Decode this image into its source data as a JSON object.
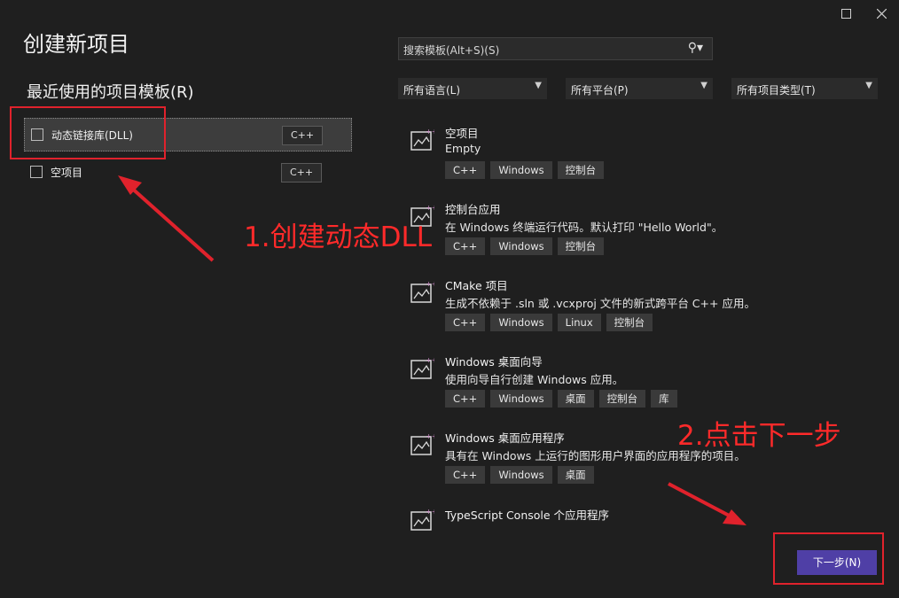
{
  "window": {
    "title": "创建新项目",
    "controls": {
      "maximize_icon": "maximize-icon",
      "close_icon": "close-icon"
    }
  },
  "recent": {
    "heading": "最近使用的项目模板(R)",
    "items": [
      {
        "label": "动态链接库(DLL)",
        "lang": "C++",
        "selected": true
      },
      {
        "label": "空项目",
        "lang": "C++",
        "selected": false
      }
    ]
  },
  "search": {
    "placeholder": "搜索模板(Alt+S)(S)",
    "icon": "search-icon"
  },
  "filters": [
    {
      "label": "所有语言(L)"
    },
    {
      "label": "所有平台(P)"
    },
    {
      "label": "所有项目类型(T)"
    }
  ],
  "templates": [
    {
      "name": "空项目",
      "desc": "Empty",
      "tags": [
        "C++",
        "Windows",
        "控制台"
      ],
      "icon": "empty-project-icon"
    },
    {
      "name": "控制台应用",
      "desc": "在 Windows 终端运行代码。默认打印 \"Hello World\"。",
      "tags": [
        "C++",
        "Windows",
        "控制台"
      ],
      "icon": "console-app-icon"
    },
    {
      "name": "CMake 项目",
      "desc": "生成不依赖于 .sln 或 .vcxproj 文件的新式跨平台 C++ 应用。",
      "tags": [
        "C++",
        "Windows",
        "Linux",
        "控制台"
      ],
      "icon": "cmake-project-icon"
    },
    {
      "name": "Windows 桌面向导",
      "desc": "使用向导自行创建 Windows 应用。",
      "tags": [
        "C++",
        "Windows",
        "桌面",
        "控制台",
        "库"
      ],
      "icon": "desktop-wizard-icon"
    },
    {
      "name": "Windows 桌面应用程序",
      "desc": "具有在 Windows 上运行的图形用户界面的应用程序的项目。",
      "tags": [
        "C++",
        "Windows",
        "桌面"
      ],
      "icon": "desktop-app-icon"
    },
    {
      "name": "TypeScript Console 个应用程序",
      "desc": "",
      "tags": [],
      "icon": "typescript-icon"
    }
  ],
  "annotations": {
    "step1": "1.创建动态DLL",
    "step2": "2.点击下一步"
  },
  "footer": {
    "next_label": "下一步(N)"
  },
  "colors": {
    "background": "#1f1f1f",
    "accent": "#4f3fa6",
    "annotation_red": "#e0222c"
  }
}
